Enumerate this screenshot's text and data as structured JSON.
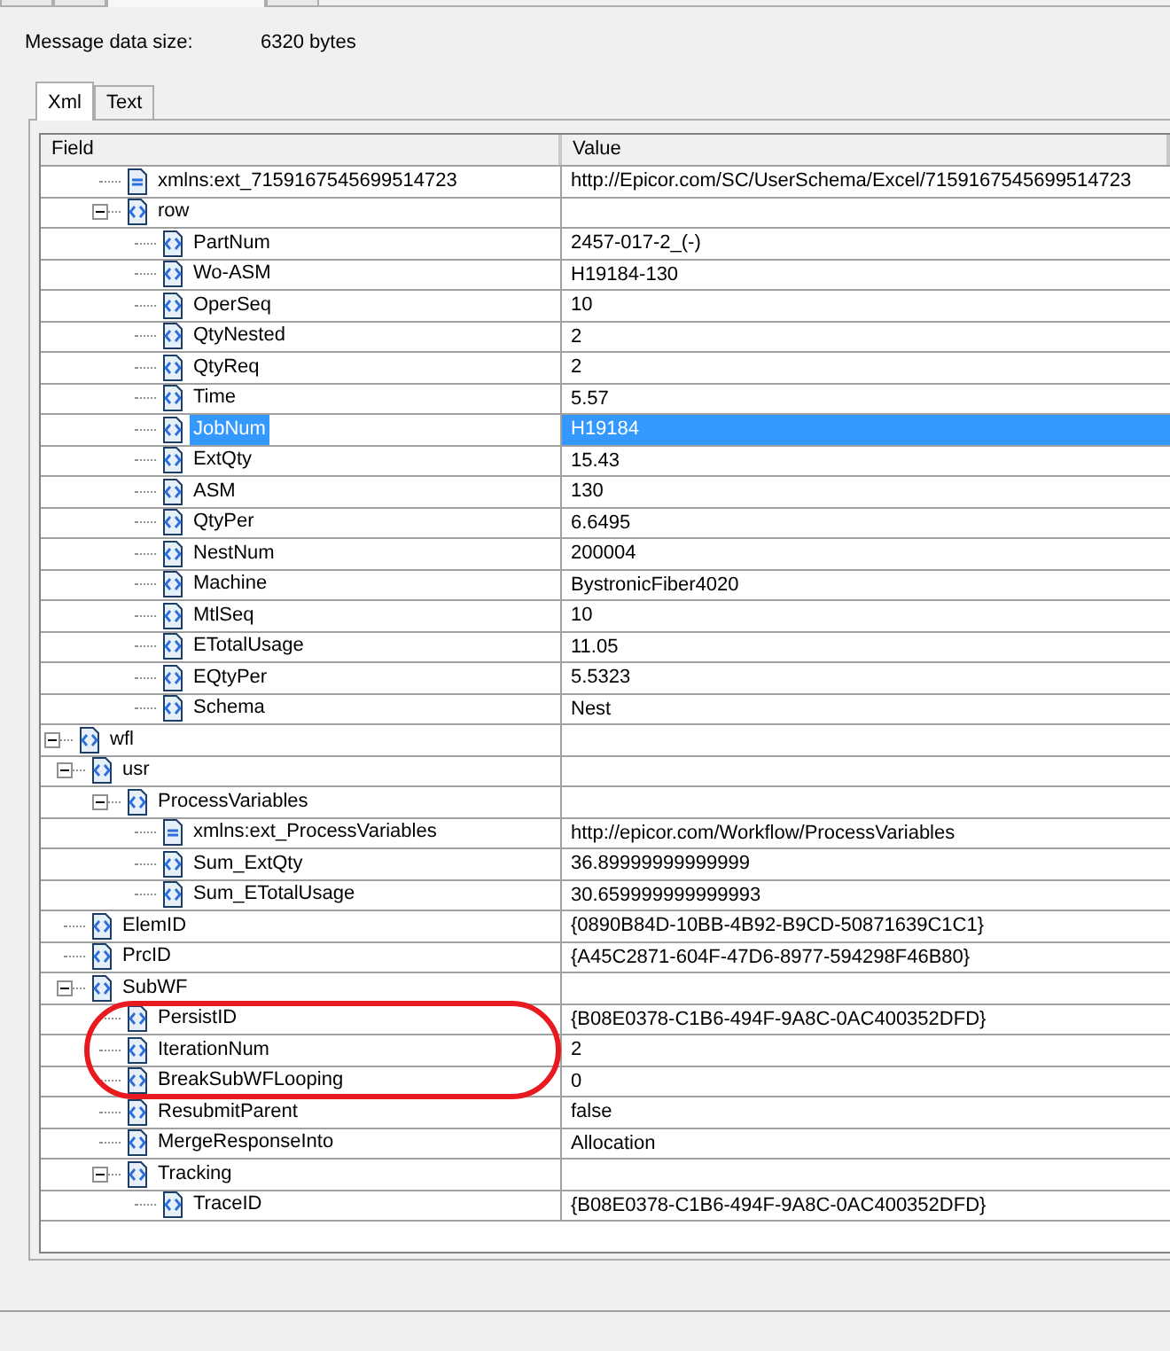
{
  "top_tabs": [
    {
      "selected": false
    },
    {
      "selected": false
    },
    {
      "selected": true
    },
    {
      "selected": false
    }
  ],
  "message_size": {
    "label": "Message data size:",
    "value": "6320 bytes"
  },
  "view_tabs": [
    {
      "label": "Xml",
      "selected": true
    },
    {
      "label": "Text",
      "selected": false
    }
  ],
  "grid": {
    "columns": [
      "Field",
      "Value"
    ],
    "nodes": [
      {
        "children": [
          {
            "children": [
              {
                "kind": "attribute",
                "field": "xmlns:ext_7159167545699514723",
                "value": "http://Epicor.com/SC/UserSchema/Excel/7159167545699514723",
                "selected": false
              },
              {
                "kind": "element",
                "field": "row",
                "expanded": true,
                "selected": false,
                "children": [
                  {
                    "kind": "element",
                    "field": "PartNum",
                    "value": "2457-017-2_(-)",
                    "selected": false
                  },
                  {
                    "kind": "element",
                    "field": "Wo-ASM",
                    "value": "H19184-130",
                    "selected": false
                  },
                  {
                    "kind": "element",
                    "field": "OperSeq",
                    "value": "10",
                    "selected": false
                  },
                  {
                    "kind": "element",
                    "field": "QtyNested",
                    "value": "2",
                    "selected": false
                  },
                  {
                    "kind": "element",
                    "field": "QtyReq",
                    "value": "2",
                    "selected": false
                  },
                  {
                    "kind": "element",
                    "field": "Time",
                    "value": "5.57",
                    "selected": false
                  },
                  {
                    "kind": "element",
                    "field": "JobNum",
                    "value": "H19184",
                    "selected": true
                  },
                  {
                    "kind": "element",
                    "field": "ExtQty",
                    "value": "15.43",
                    "selected": false
                  },
                  {
                    "kind": "element",
                    "field": "ASM",
                    "value": "130",
                    "selected": false
                  },
                  {
                    "kind": "element",
                    "field": "QtyPer",
                    "value": "6.6495",
                    "selected": false
                  },
                  {
                    "kind": "element",
                    "field": "NestNum",
                    "value": "200004",
                    "selected": false
                  },
                  {
                    "kind": "element",
                    "field": "Machine",
                    "value": "BystronicFiber4020",
                    "selected": false
                  },
                  {
                    "kind": "element",
                    "field": "MtlSeq",
                    "value": "10",
                    "selected": false
                  },
                  {
                    "kind": "element",
                    "field": "ETotalUsage",
                    "value": "11.05",
                    "selected": false
                  },
                  {
                    "kind": "element",
                    "field": "EQtyPer",
                    "value": "5.5323",
                    "selected": false
                  },
                  {
                    "kind": "element",
                    "field": "Schema",
                    "value": "Nest",
                    "selected": false
                  }
                ]
              }
            ]
          }
        ]
      },
      {
        "kind": "element",
        "field": "wfl",
        "expanded": true,
        "selected": false,
        "children": [
          {
            "kind": "element",
            "field": "usr",
            "expanded": true,
            "selected": false,
            "children": [
              {
                "kind": "element",
                "field": "ProcessVariables",
                "expanded": true,
                "selected": false,
                "children": [
                  {
                    "kind": "attribute",
                    "field": "xmlns:ext_ProcessVariables",
                    "value": "http://epicor.com/Workflow/ProcessVariables",
                    "selected": false
                  },
                  {
                    "kind": "element",
                    "field": "Sum_ExtQty",
                    "value": "36.89999999999999",
                    "selected": false
                  },
                  {
                    "kind": "element",
                    "field": "Sum_ETotalUsage",
                    "value": "30.659999999999993",
                    "selected": false
                  }
                ]
              }
            ]
          },
          {
            "kind": "element",
            "field": "ElemID",
            "value": "{0890B84D-10BB-4B92-B9CD-50871639C1C1}",
            "selected": false
          },
          {
            "kind": "element",
            "field": "PrcID",
            "value": "{A45C2871-604F-47D6-8977-594298F46B80}",
            "selected": false
          },
          {
            "kind": "element",
            "field": "SubWF",
            "expanded": true,
            "selected": false,
            "children": [
              {
                "kind": "element",
                "field": "PersistID",
                "value": "{B08E0378-C1B6-494F-9A8C-0AC400352DFD}",
                "selected": false,
                "circled": true
              },
              {
                "kind": "element",
                "field": "IterationNum",
                "value": "2",
                "selected": false,
                "circled": true
              },
              {
                "kind": "element",
                "field": "BreakSubWFLooping",
                "value": "0",
                "selected": false,
                "circled": true
              },
              {
                "kind": "element",
                "field": "ResubmitParent",
                "value": "false",
                "selected": false
              },
              {
                "kind": "element",
                "field": "MergeResponseInto",
                "value": "Allocation",
                "selected": false
              },
              {
                "kind": "element",
                "field": "Tracking",
                "expanded": true,
                "selected": false,
                "children": [
                  {
                    "kind": "element",
                    "field": "TraceID",
                    "value": "{B08E0378-C1B6-494F-9A8C-0AC400352DFD}",
                    "selected": false
                  }
                ]
              }
            ]
          }
        ]
      }
    ]
  },
  "annotation": {
    "color": "#e8191f"
  }
}
